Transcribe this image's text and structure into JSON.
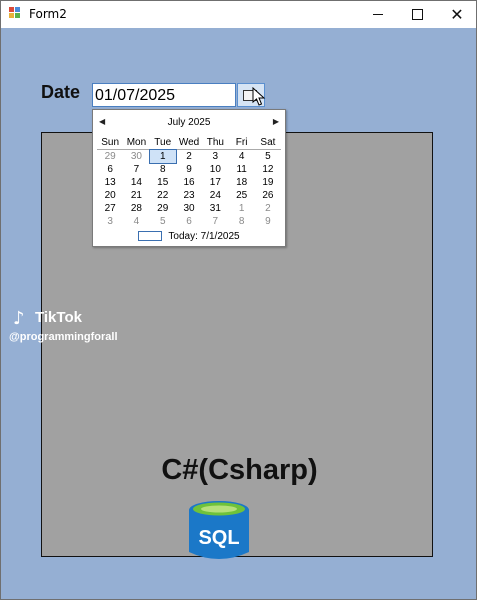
{
  "window": {
    "title": "Form2"
  },
  "titlebar": {
    "minimize": "minimize-icon",
    "maximize": "maximize-icon",
    "close": "close-icon"
  },
  "form": {
    "date_label": "Date",
    "date_value": "01/07/2025"
  },
  "calendar": {
    "month_label": "July 2025",
    "weekdays": [
      "Sun",
      "Mon",
      "Tue",
      "Wed",
      "Thu",
      "Fri",
      "Sat"
    ],
    "weeks": [
      [
        "29",
        "30",
        "1",
        "2",
        "3",
        "4",
        "5"
      ],
      [
        "6",
        "7",
        "8",
        "9",
        "10",
        "11",
        "12"
      ],
      [
        "13",
        "14",
        "15",
        "16",
        "17",
        "18",
        "19"
      ],
      [
        "20",
        "21",
        "22",
        "23",
        "24",
        "25",
        "26"
      ],
      [
        "27",
        "28",
        "29",
        "30",
        "31",
        "1",
        "2"
      ],
      [
        "3",
        "4",
        "5",
        "6",
        "7",
        "8",
        "9"
      ]
    ],
    "today_label": "Today: 7/1/2025",
    "selected": "1"
  },
  "overlay": {
    "tiktok_brand": "TikTok",
    "tiktok_handle": "@programmingforall",
    "caption": "C#(Csharp)",
    "sql_label": "SQL"
  },
  "colors": {
    "form_background": "#95afd3",
    "panel_background": "#a1a1a1",
    "sql_blue": "#1b78c8",
    "sql_lid": "#6fc23a"
  }
}
